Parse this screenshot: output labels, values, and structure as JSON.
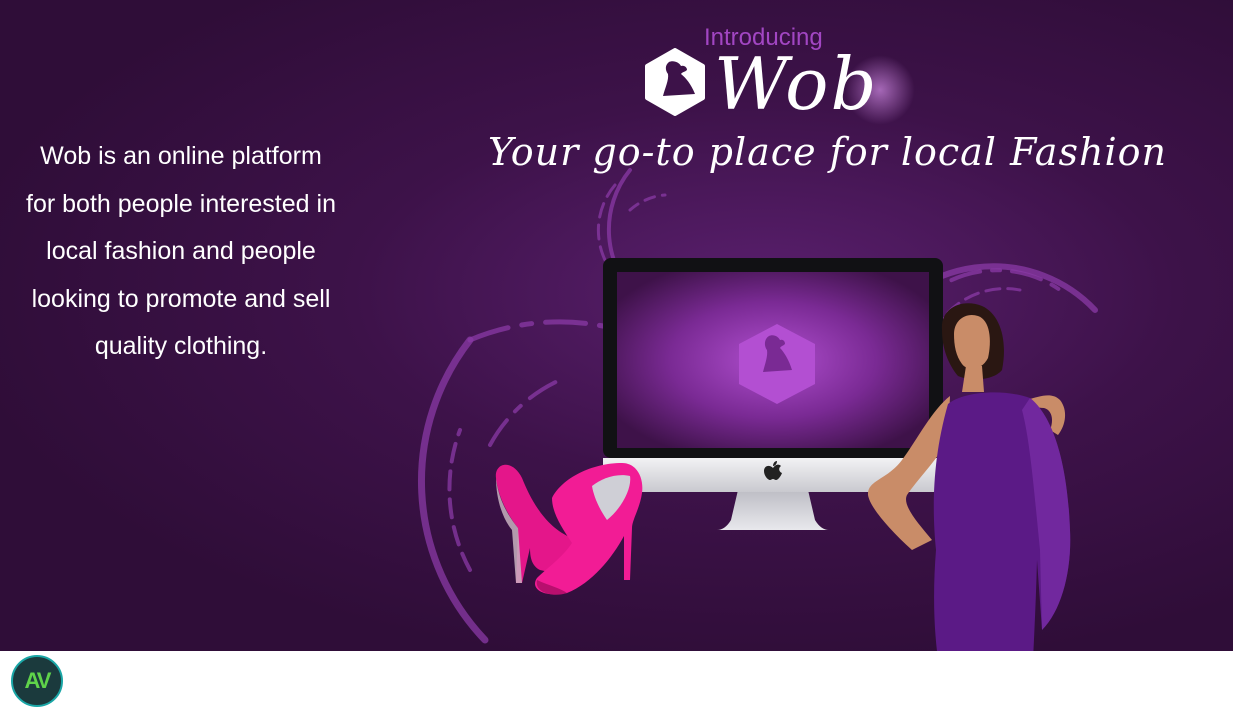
{
  "hero": {
    "introducing": "Introducing",
    "brand_name": "Wob",
    "tagline": "Your go-to place for local Fashion",
    "description_lines": [
      "Wob is an online platform",
      "for both people interested in",
      "local fashion and people",
      "looking to promote and sell",
      "quality clothing."
    ]
  },
  "footer": {
    "badge_text": "AV"
  },
  "colors": {
    "background": "#2f0d38",
    "accent": "#a246c3",
    "logo_purple": "#b04fcf",
    "shoe_pink": "#e8198b",
    "dress_purple": "#5b1a86"
  },
  "icons": [
    "wob-logo-icon",
    "apple-logo-icon",
    "av-logo-icon"
  ]
}
